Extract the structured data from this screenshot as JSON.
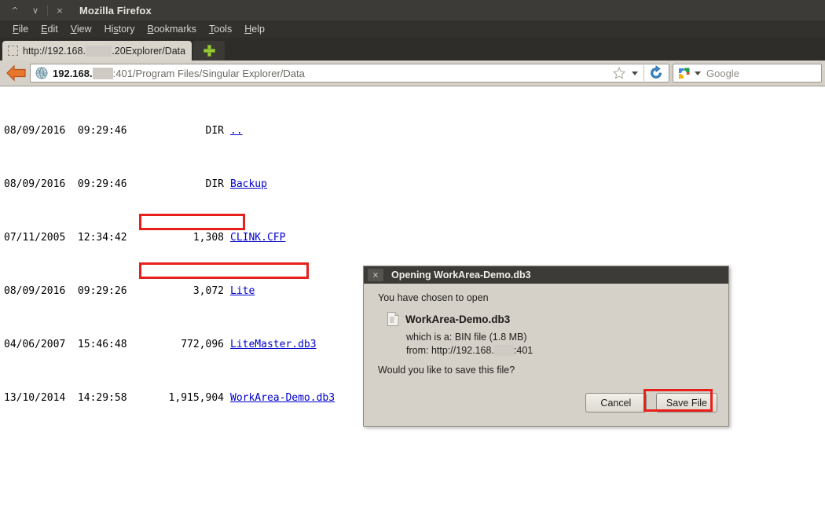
{
  "window": {
    "title": "Mozilla Firefox",
    "controls": {
      "minimize": "ⱏ",
      "maximize": "ⱟ",
      "close": "×"
    }
  },
  "menubar": {
    "items": [
      {
        "name": "file",
        "pre": "",
        "acc": "F",
        "post": "ile"
      },
      {
        "name": "edit",
        "pre": "",
        "acc": "E",
        "post": "dit"
      },
      {
        "name": "view",
        "pre": "",
        "acc": "V",
        "post": "iew"
      },
      {
        "name": "history",
        "pre": "Hi",
        "acc": "s",
        "post": "tory"
      },
      {
        "name": "bookmarks",
        "pre": "",
        "acc": "B",
        "post": "ookmarks"
      },
      {
        "name": "tools",
        "pre": "",
        "acc": "T",
        "post": "ools"
      },
      {
        "name": "help",
        "pre": "",
        "acc": "H",
        "post": "elp"
      }
    ]
  },
  "tabbar": {
    "tab_label_prefix": "http://192.168.",
    "tab_label_redacted": "XXXX",
    "tab_label_suffix": ".20Explorer/Data",
    "newtab_title": "+"
  },
  "navbar": {
    "back_title": "Back",
    "url_host_prefix": "192.168.",
    "url_host_redacted": "XXX",
    "url_path": ":401/Program Files/Singular Explorer/Data",
    "star_title": "Bookmark this page",
    "reload_title": "Reload",
    "search_placeholder": "Google"
  },
  "listing": {
    "columns": [
      "date",
      "size",
      "name"
    ],
    "rows": [
      {
        "date": "08/09/2016  09:29:46",
        "size": "DIR",
        "name": "..",
        "is_link": true
      },
      {
        "date": "08/09/2016  09:29:46",
        "size": "DIR",
        "name": "Backup",
        "is_link": true
      },
      {
        "date": "07/11/2005  12:34:42",
        "size": "1,308",
        "name": "CLINK.CFP",
        "is_link": true
      },
      {
        "date": "08/09/2016  09:29:26",
        "size": "3,072",
        "name": "Lite",
        "is_link": true
      },
      {
        "date": "04/06/2007  15:46:48",
        "size": "772,096",
        "name": "LiteMaster.db3",
        "is_link": true
      },
      {
        "date": "13/10/2014  14:29:58",
        "size": "1,915,904",
        "name": "WorkArea-Demo.db3",
        "is_link": true
      }
    ]
  },
  "annotations": {
    "color": "#e8201b",
    "boxes": [
      "dir-backup-row",
      "workarea-demo-row",
      "save-file-button"
    ]
  },
  "dialog": {
    "title": "Opening WorkArea-Demo.db3",
    "close_glyph": "×",
    "intro": "You have chosen to open",
    "filename": "WorkArea-Demo.db3",
    "type_label": "which is a:",
    "type_value": "BIN file (1.8 MB)",
    "from_label": "from:",
    "from_value_prefix": "http://192.168.",
    "from_value_redacted": "XXX",
    "from_value_suffix": ":401",
    "question": "Would you like to save this file?",
    "cancel_label": "Cancel",
    "save_label": "Save File"
  },
  "colors": {
    "titlebar": "#3c3b37",
    "toolbar": "#d5d0c8",
    "link": "#0000cc",
    "annotation": "#e8201b",
    "page_bg": "#ffffff"
  }
}
